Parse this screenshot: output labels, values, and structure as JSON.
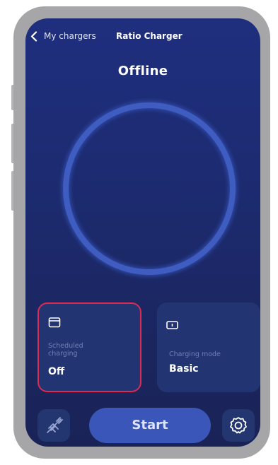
{
  "header": {
    "back_label": "My chargers",
    "charger_name": "Ratio Charger"
  },
  "status": {
    "text": "Offline"
  },
  "cards": {
    "scheduled": {
      "icon": "calendar-icon",
      "label_line1": "Scheduled",
      "label_line2": "charging",
      "value": "Off"
    },
    "mode": {
      "icon": "battery-icon",
      "label": "Charging mode",
      "value": "Basic"
    }
  },
  "controls": {
    "left_icon": "plug-off-icon",
    "start_label": "Start",
    "right_icon": "gear-icon"
  },
  "colors": {
    "background": "#1f2f7e",
    "ring": "#3f5cc0",
    "highlight": "#e0294f",
    "start_button": "#3a56b8"
  }
}
